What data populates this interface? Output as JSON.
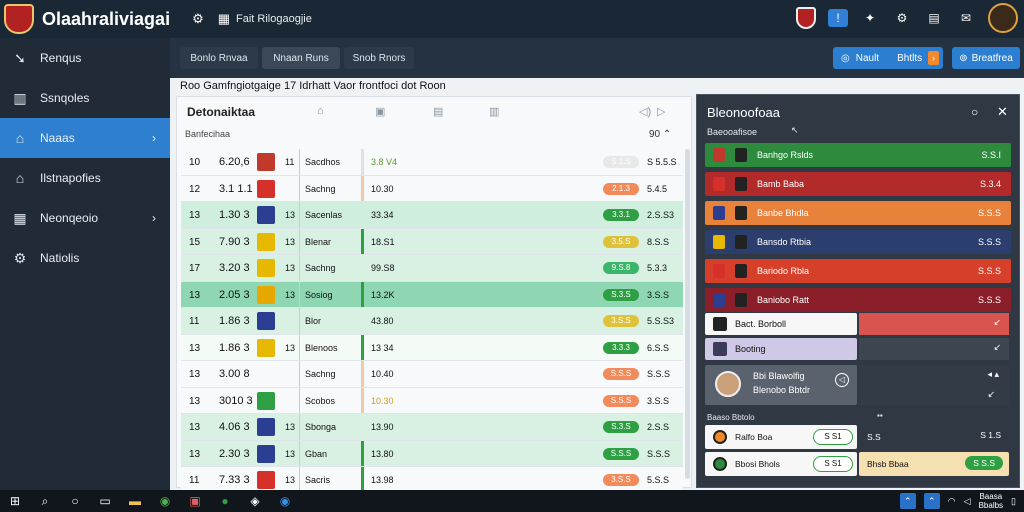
{
  "app": {
    "title": "Olaahraliviagai",
    "subtitle": "Fait Rilogaogjie",
    "brand_color": "#b22222",
    "accent": "#2e7fcf"
  },
  "top_icons": [
    "alert-icon",
    "bell-icon",
    "settings-icon",
    "grid-icon",
    "chat-icon"
  ],
  "sidebar": {
    "items": [
      {
        "label": "Renqus",
        "icon": "arrow-icon",
        "active": false,
        "chevron": false
      },
      {
        "label": "Ssnqoles",
        "icon": "book-icon",
        "active": false,
        "chevron": false
      },
      {
        "label": "Naaas",
        "icon": "home-icon",
        "active": true,
        "chevron": true
      },
      {
        "label": "Ilstnapofies",
        "icon": "stats-icon",
        "active": false,
        "chevron": false
      },
      {
        "label": "Neonqeoio",
        "icon": "calendar-icon",
        "active": false,
        "chevron": true
      },
      {
        "label": "Natiolis",
        "icon": "gear-icon",
        "active": false,
        "chevron": false
      }
    ]
  },
  "tabs": [
    {
      "label": "Bonlo Rnvaa",
      "selected": false
    },
    {
      "label": "Nnaan Runs",
      "selected": true
    },
    {
      "label": "Snob Rnors",
      "selected": false
    }
  ],
  "actions": {
    "primary_label": "Nault",
    "primary_extra": "Bhtlts",
    "secondary_label": "Breatfrea"
  },
  "breadcrumb": "Roo Gamfngiotgaige 17 Idrhatt Vaor frontfoci dot Roon",
  "table": {
    "title": "Detonaiktaa",
    "subtitle": "Banfecihaa",
    "count": "90",
    "rows": [
      {
        "rank": "10",
        "value": "6.20,6",
        "badge": "#c0392b",
        "num": "11",
        "team": "Sacdhos",
        "score": "3.8 V4",
        "score_color": "#5a9a2a",
        "pill": "S 1.S",
        "pill_color": "#e8e8e8",
        "odd": "S 5.5.S",
        "bg": "#f7f9fa",
        "div": "#dce2e6"
      },
      {
        "rank": "12",
        "value": "3.1 1.1",
        "badge": "#d6302a",
        "num": "",
        "team": "Sachng",
        "score": "10.30",
        "score_color": "#111",
        "pill": "2.1.3",
        "pill_color": "#f28a5b",
        "odd": "5.4.5",
        "bg": "#f7f9fa",
        "div": "#f0c9a8"
      },
      {
        "rank": "13",
        "value": "1.30 3",
        "badge": "#2c3e91",
        "num": "13",
        "team": "Sacenlas",
        "score": "33.34",
        "score_color": "#111",
        "pill": "3.3.1",
        "pill_color": "#2ea043",
        "odd": "2.S.S3",
        "bg": "#cfeedd",
        "div": "#cfeedd"
      },
      {
        "rank": "15",
        "value": "7.90 3",
        "badge": "#e6b800",
        "num": "13",
        "team": "Blenar",
        "score": "18.S1",
        "score_color": "#111",
        "pill": "3.5.S",
        "pill_color": "#e0c23a",
        "odd": "8.S.S",
        "bg": "#d8f1e3",
        "div": "#2ea043"
      },
      {
        "rank": "17",
        "value": "3.20 3",
        "badge": "#e6b800",
        "num": "13",
        "team": "Sachng",
        "score": "99.S8",
        "score_color": "#111",
        "pill": "9.S.8",
        "pill_color": "#3ab56a",
        "odd": "5.3.3",
        "bg": "#d8f1e3",
        "div": "#d8f1e3"
      },
      {
        "rank": "13",
        "value": "2.05 3",
        "badge": "#e6a700",
        "num": "13",
        "team": "Sosiog",
        "score": "13.2K",
        "score_color": "#111",
        "pill": "S.3.S",
        "pill_color": "#2ea043",
        "odd": "3.S.S",
        "bg": "#8fd6b3",
        "div": "#2ea043"
      },
      {
        "rank": "11",
        "value": "1.86 3",
        "badge": "#2c3e91",
        "num": "",
        "team": "Blor",
        "score": "43.80",
        "score_color": "#111",
        "pill": "3.S.S",
        "pill_color": "#e0c23a",
        "odd": "5.S.S3",
        "bg": "#d8f1e3",
        "div": "#d8f1e3"
      },
      {
        "rank": "13",
        "value": "1.86 3",
        "badge": "#e6b800",
        "num": "13",
        "team": "Blenoos",
        "score": "13 34",
        "score_color": "#111",
        "pill": "3.3.3",
        "pill_color": "#2ea043",
        "odd": "6.S.S",
        "bg": "#f4faf6",
        "div": "#2ea043"
      },
      {
        "rank": "13",
        "value": "3.00 8",
        "badge": "#f7f9fa",
        "num": "",
        "team": "Sachng",
        "score": "10.40",
        "score_color": "#111",
        "pill": "S.S.S",
        "pill_color": "#f28a5b",
        "odd": "S.S.S",
        "bg": "#f7f9fa",
        "div": "#f0c9a8"
      },
      {
        "rank": "13",
        "value": "3010 3",
        "badge": "#2ea043",
        "num": "",
        "team": "Scobos",
        "score": "10.30",
        "score_color": "#d4a017",
        "pill": "S.S.S",
        "pill_color": "#f28a5b",
        "odd": "3.S.S",
        "bg": "#f7f9fa",
        "div": "#f0c9a8"
      },
      {
        "rank": "13",
        "value": "4.06 3",
        "badge": "#2c3e91",
        "num": "13",
        "team": "Sbonga",
        "score": "13.90",
        "score_color": "#111",
        "pill": "S.3.S",
        "pill_color": "#2ea043",
        "odd": "2.S.S",
        "bg": "#d8f1e3",
        "div": "#d8f1e3"
      },
      {
        "rank": "13",
        "value": "2.30 3",
        "badge": "#2c3e91",
        "num": "13",
        "team": "Gban",
        "score": "13.80",
        "score_color": "#111",
        "pill": "S.S.S",
        "pill_color": "#2ea043",
        "odd": "S.S.S",
        "bg": "#d8f1e3",
        "div": "#2ea043"
      },
      {
        "rank": "11",
        "value": "7.33 3",
        "badge": "#d6302a",
        "num": "13",
        "team": "Sacris",
        "score": "13.98",
        "score_color": "#111",
        "pill": "3.S.S",
        "pill_color": "#f28a5b",
        "odd": "5.S.S",
        "bg": "#f7f9fa",
        "div": "#2ea043"
      }
    ]
  },
  "panel": {
    "title": "Bleonoofoaa",
    "subtitle": "Baeooafisoe",
    "matches": [
      {
        "team": "Banhgo Rslds",
        "value": "S.S.I",
        "bg": "#2e8b3e",
        "sq": "#c0392b"
      },
      {
        "team": "Bamb Baba",
        "value": "S.3.4",
        "bg": "#b22a2a",
        "sq": "#d6302a"
      },
      {
        "team": "Banbe Bhdla",
        "value": "S.S.S",
        "bg": "#e8813a",
        "sq": "#2c3e91"
      },
      {
        "team": "Bansdo Rtbia",
        "value": "S.S.S",
        "bg": "#2c3e6e",
        "sq": "#e6b800"
      },
      {
        "team": "Bariodo Rbla",
        "value": "S.S.S",
        "bg": "#d6402a",
        "sq": "#d6302a"
      },
      {
        "team": "Baniobo Ratt",
        "value": "S.S.S",
        "bg": "#8a1f2a",
        "sq": "#2c3e91"
      }
    ],
    "standings": [
      {
        "label": "Bact. Borboll",
        "bg": "#f7f7f7",
        "rbg": "#d9534f"
      },
      {
        "label": "Booting",
        "bg": "#cfc8e6",
        "rbg": "#3c4550"
      }
    ],
    "player": {
      "name": "Bbi Blawolfig",
      "role": "Blenobo Bbtdr"
    },
    "section2": "Baaso Bbtolo",
    "cards": [
      {
        "label": "Ralfo Boa",
        "score": "S S1",
        "right_label": "S.S",
        "right_value": "S 1.S"
      },
      {
        "label": "Bbosi Bhols",
        "score": "S S1",
        "right_label": "Bhsb Bbaa",
        "right_value": "S S.S"
      }
    ]
  },
  "taskbar": {
    "icons": [
      "windows-icon",
      "search-icon",
      "circle-icon",
      "task-icon",
      "folder-icon",
      "chrome-icon",
      "app-icon",
      "spotify-icon",
      "discord-icon",
      "edge-icon"
    ],
    "time": "Baasa",
    "date": "Bbalbs"
  }
}
